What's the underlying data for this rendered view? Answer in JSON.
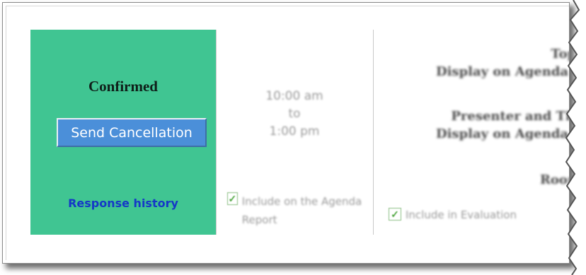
{
  "status": {
    "title": "Confirmed",
    "cancel_button_label": "Send Cancellation",
    "history_link": "Response history"
  },
  "schedule": {
    "start": "10:00 am",
    "separator": "to",
    "end": "1:00 pm",
    "agenda_checkbox_label": "Include on the Agenda Report",
    "agenda_checked": true
  },
  "details": {
    "topic_label": "Topi",
    "topic_display": "Display on Agenda a",
    "presenter_label": "Presenter and Titl",
    "presenter_display": "Display on Agenda a",
    "room_label": "Room",
    "evaluation_checkbox_label": "Include in Evaluation",
    "evaluation_checked": true
  },
  "colors": {
    "status_bg": "#40c592",
    "button_bg": "#4b8fd9",
    "link": "#1538c7"
  }
}
